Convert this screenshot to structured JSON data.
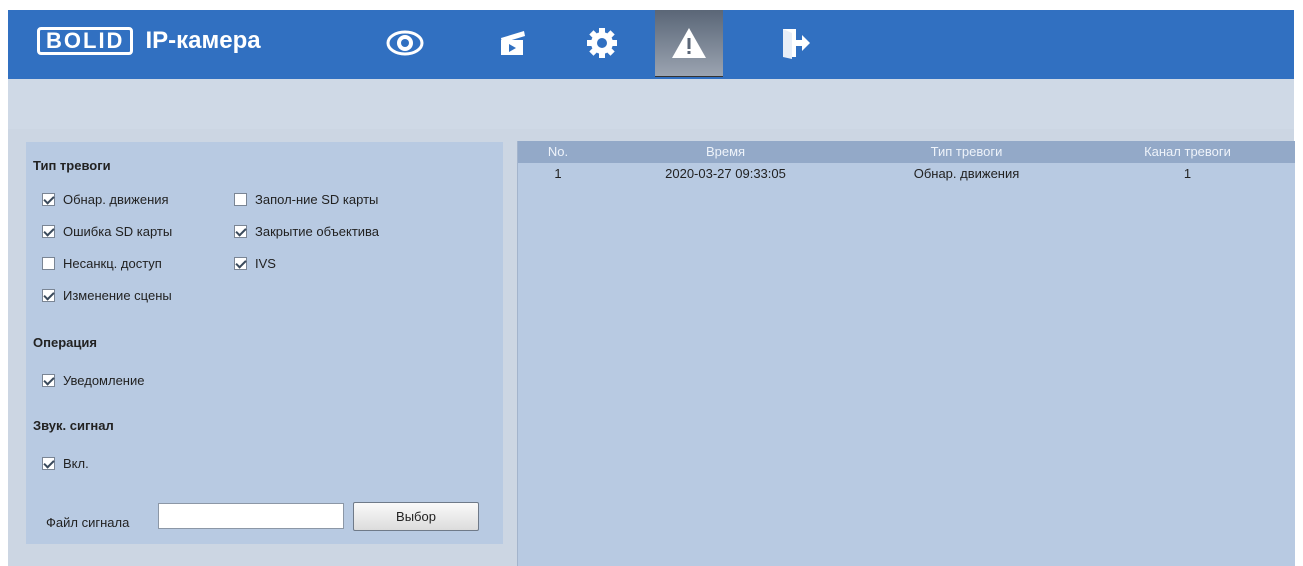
{
  "header": {
    "logo_text": "BOLID",
    "product_name": "IP-камера",
    "nav": [
      {
        "icon": "eye-icon",
        "active": false
      },
      {
        "icon": "clapperboard-icon",
        "active": false
      },
      {
        "icon": "gear-icon",
        "active": false
      },
      {
        "icon": "warning-icon",
        "active": true
      },
      {
        "icon": "logout-icon",
        "active": false
      }
    ],
    "colors": {
      "topbar": "#3170c1",
      "panel": "#b8cae2",
      "table_header": "#93a9c8"
    }
  },
  "alarm_type": {
    "title": "Тип тревоги",
    "items": [
      {
        "label": "Обнар. движения",
        "checked": true
      },
      {
        "label": "Запол-ние SD карты",
        "checked": false
      },
      {
        "label": "Ошибка SD карты",
        "checked": true
      },
      {
        "label": "Закрытие объектива",
        "checked": true
      },
      {
        "label": "Несанкц. доступ",
        "checked": false
      },
      {
        "label": "IVS",
        "checked": true
      },
      {
        "label": "Изменение сцены",
        "checked": true
      }
    ]
  },
  "operation": {
    "title": "Операция",
    "items": [
      {
        "label": "Уведомление",
        "checked": true
      }
    ]
  },
  "sound": {
    "title": "Звук. сигнал",
    "items": [
      {
        "label": "Вкл.",
        "checked": true
      }
    ],
    "file_label": "Файл сигнала",
    "file_value": "",
    "select_button": "Выбор"
  },
  "table": {
    "columns": [
      "No.",
      "Время",
      "Тип тревоги",
      "Канал тревоги"
    ],
    "rows": [
      [
        "1",
        "2020-03-27 09:33:05",
        "Обнар. движения",
        "1"
      ]
    ]
  }
}
